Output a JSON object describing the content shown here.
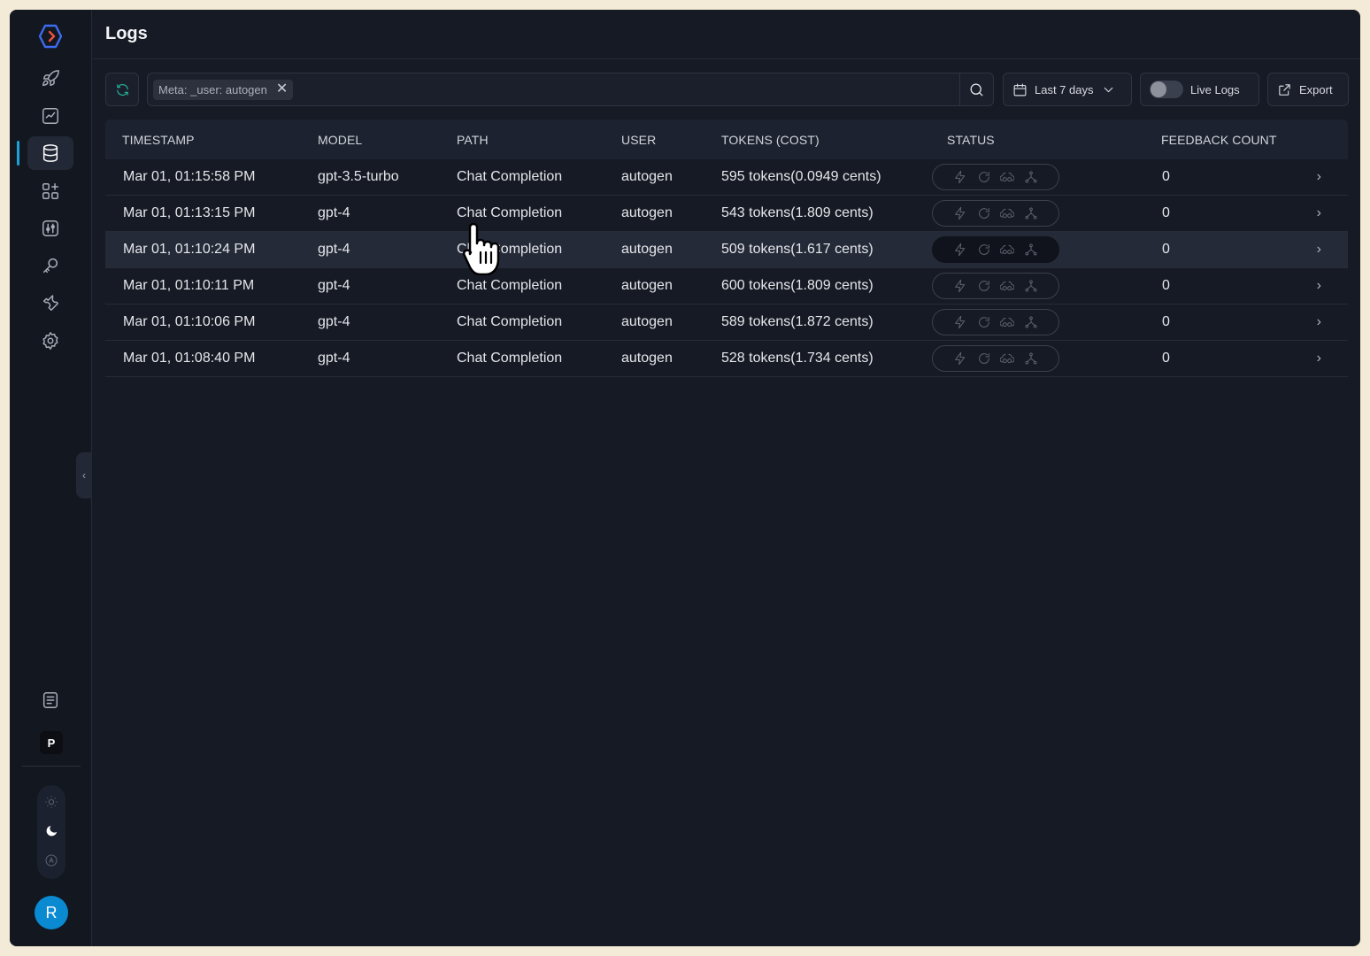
{
  "header": {
    "title": "Logs"
  },
  "sidebar": {
    "items": [
      {
        "icon": "rocket-icon"
      },
      {
        "icon": "analytics-icon"
      },
      {
        "icon": "database-icon",
        "active": true
      },
      {
        "icon": "apps-add-icon"
      },
      {
        "icon": "sliders-icon"
      },
      {
        "icon": "key-icon"
      },
      {
        "icon": "wrench-icon"
      },
      {
        "icon": "gear-icon"
      }
    ],
    "docs_icon": "document-icon",
    "workspace_letter": "P",
    "avatar_letter": "R",
    "accent_color": "#1aa3d6"
  },
  "toolbar": {
    "filter_chip": "Meta: _user: autogen",
    "date_range": "Last 7 days",
    "live_logs_label": "Live Logs",
    "live_logs_enabled": false,
    "export_label": "Export"
  },
  "table": {
    "columns": [
      "TIMESTAMP",
      "MODEL",
      "PATH",
      "USER",
      "TOKENS (COST)",
      "STATUS",
      "FEEDBACK COUNT"
    ],
    "rows": [
      {
        "timestamp": "Mar 01, 01:15:58 PM",
        "model": "gpt-3.5-turbo",
        "path": "Chat Completion",
        "user": "autogen",
        "tokens": "595 tokens(0.0949 cents)",
        "feedback": "0"
      },
      {
        "timestamp": "Mar 01, 01:13:15 PM",
        "model": "gpt-4",
        "path": "Chat Completion",
        "user": "autogen",
        "tokens": "543 tokens(1.809 cents)",
        "feedback": "0"
      },
      {
        "timestamp": "Mar 01, 01:10:24 PM",
        "model": "gpt-4",
        "path": "Chat Completion",
        "user": "autogen",
        "tokens": "509 tokens(1.617 cents)",
        "feedback": "0"
      },
      {
        "timestamp": "Mar 01, 01:10:11 PM",
        "model": "gpt-4",
        "path": "Chat Completion",
        "user": "autogen",
        "tokens": "600 tokens(1.809 cents)",
        "feedback": "0"
      },
      {
        "timestamp": "Mar 01, 01:10:06 PM",
        "model": "gpt-4",
        "path": "Chat Completion",
        "user": "autogen",
        "tokens": "589 tokens(1.872 cents)",
        "feedback": "0"
      },
      {
        "timestamp": "Mar 01, 01:08:40 PM",
        "model": "gpt-4",
        "path": "Chat Completion",
        "user": "autogen",
        "tokens": "528 tokens(1.734 cents)",
        "feedback": "0"
      }
    ],
    "status_icons": [
      "bolt-icon",
      "retry-icon",
      "cache-icon",
      "fallback-icon"
    ]
  },
  "colors": {
    "background": "#161a24",
    "refresh_accent": "#23b89c"
  }
}
